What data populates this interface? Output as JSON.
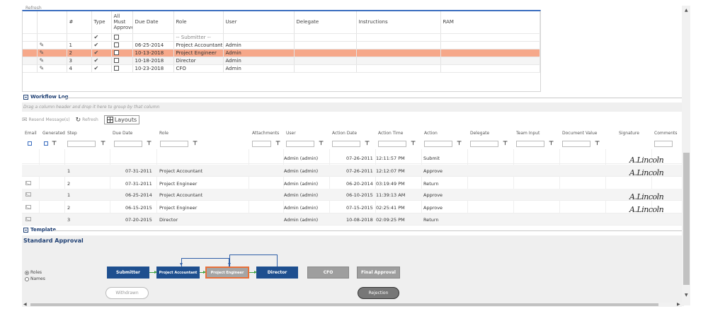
{
  "top_grid": {
    "refresh_label": "Refresh",
    "columns": [
      "#",
      "Type",
      "All Must Approve",
      "Due Date",
      "Role",
      "User",
      "Delegate",
      "Instructions",
      "RAM"
    ],
    "filter_role_placeholder": "-- Submitter --",
    "rows": [
      {
        "num": "1",
        "due_date": "06-25-2014",
        "role": "Project Accountant",
        "user": "Admin",
        "selected": false
      },
      {
        "num": "2",
        "due_date": "10-13-2018",
        "role": "Project Engineer",
        "user": "Admin",
        "selected": true
      },
      {
        "num": "3",
        "due_date": "10-18-2018",
        "role": "Director",
        "user": "Admin",
        "selected": false
      },
      {
        "num": "4",
        "due_date": "10-23-2018",
        "role": "CFO",
        "user": "Admin",
        "selected": false
      }
    ]
  },
  "workflow_log": {
    "title": "Workflow Log",
    "drag_hint": "Drag a column header and drop it here to group by that column",
    "toolbar": {
      "resend": "Resend Message(s)",
      "refresh": "Refresh",
      "layouts": "Layouts"
    },
    "columns": [
      "Email",
      "Generated",
      "Step",
      "Due Date",
      "Role",
      "Attachments",
      "User",
      "Action Date",
      "Action Time",
      "Action",
      "Delegate",
      "Team Input",
      "Document Value",
      "Signature",
      "Comments"
    ],
    "rows": [
      {
        "email": false,
        "step": "",
        "due_date": "",
        "role": "",
        "user": "Admin (admin)",
        "action_date": "07-26-2011",
        "action_time": "12:11:57 PM",
        "action": "Submit",
        "signature": "A.Lincoln"
      },
      {
        "email": false,
        "step": "1",
        "due_date": "07-31-2011",
        "role": "Project Accountant",
        "user": "Admin (admin)",
        "action_date": "07-26-2011",
        "action_time": "12:12:07 PM",
        "action": "Approve",
        "signature": "A.Lincoln"
      },
      {
        "email": true,
        "step": "2",
        "due_date": "07-31-2011",
        "role": "Project Engineer",
        "user": "Admin (admin)",
        "action_date": "06-20-2014",
        "action_time": "03:19:49 PM",
        "action": "Return",
        "signature": ""
      },
      {
        "email": true,
        "step": "1",
        "due_date": "06-25-2014",
        "role": "Project Accountant",
        "user": "Admin (admin)",
        "action_date": "06-10-2015",
        "action_time": "11:39:13 AM",
        "action": "Approve",
        "signature": "A.Lincoln"
      },
      {
        "email": true,
        "step": "2",
        "due_date": "06-15-2015",
        "role": "Project Engineer",
        "user": "Admin (admin)",
        "action_date": "07-15-2015",
        "action_time": "02:25:41 PM",
        "action": "Approve",
        "signature": "A.Lincoln"
      },
      {
        "email": true,
        "step": "3",
        "due_date": "07-20-2015",
        "role": "Director",
        "user": "Admin (admin)",
        "action_date": "10-08-2018",
        "action_time": "02:09:25 PM",
        "action": "Return",
        "signature": ""
      }
    ]
  },
  "template": {
    "title": "Template",
    "name": "Standard Approval",
    "radios": [
      {
        "label": "Roles",
        "checked": true
      },
      {
        "label": "Names",
        "checked": false
      }
    ],
    "nodes": [
      "Submitter",
      "Project Accountant",
      "Project Engineer",
      "Director",
      "CFO",
      "Final Approval"
    ],
    "withdrawn": "Withdrawn",
    "rejection": "Rejection"
  },
  "colors": {
    "selected_row": "#f6a88a",
    "node_blue": "#1e4f8f",
    "current_border": "#e8703a",
    "flow_green": "#3ea13e",
    "section_title": "#1e3f73"
  }
}
